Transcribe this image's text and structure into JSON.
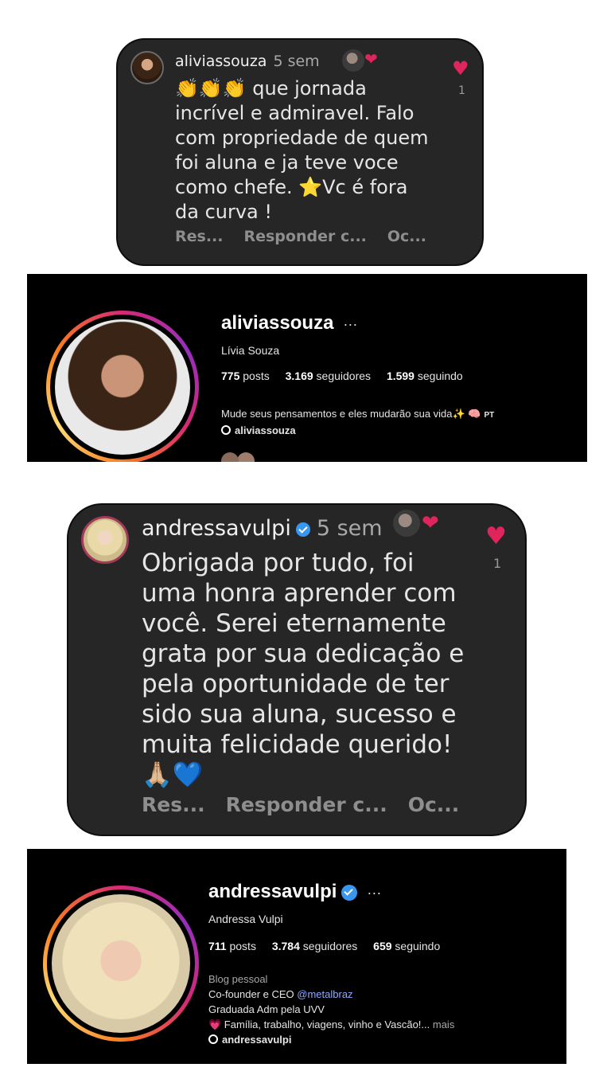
{
  "comment1": {
    "username": "aliviassouza",
    "time": "5 sem",
    "heart_badge": "❤",
    "lines": [
      "👏👏👏 que jornada",
      "incrível e admiravel. Falo",
      "com propriedade de quem",
      "foi aluna e ja teve voce",
      "como chefe. ⭐Vc é fora",
      "da curva !"
    ],
    "actions": [
      "Res...",
      "Responder c...",
      "Oc..."
    ],
    "like_icon": "♥",
    "like_count": "1"
  },
  "profile1": {
    "username": "aliviassouza",
    "more": "···",
    "name": "Lívia Souza",
    "posts_num": "775",
    "posts_label": "posts",
    "followers_num": "3.169",
    "followers_label": "seguidores",
    "following_num": "1.599",
    "following_label": "seguindo",
    "bio_line": "Mude seus pensamentos e eles mudarão sua vida✨ 🧠",
    "bio_pt": "PT",
    "threads_handle": "aliviassouza"
  },
  "comment2": {
    "username": "andressavulpi",
    "time": "5 sem",
    "heart_badge": "❤",
    "lines": [
      "Obrigada por tudo, foi",
      "uma honra aprender com",
      "você. Serei eternamente",
      "grata por sua dedicação e",
      "pela oportunidade de ter",
      "sido sua aluna, sucesso e",
      "muita felicidade querido!",
      "🙏🏼💙"
    ],
    "actions": [
      "Res...",
      "Responder c...",
      "Oc..."
    ],
    "like_icon": "♥",
    "like_count": "1"
  },
  "profile2": {
    "username": "andressavulpi",
    "more": "···",
    "name": "Andressa Vulpi",
    "posts_num": "711",
    "posts_label": "posts",
    "followers_num": "3.784",
    "followers_label": "seguidores",
    "following_num": "659",
    "following_label": "seguindo",
    "category": "Blog pessoal",
    "bio_line1_prefix": "Co-founder e CEO ",
    "bio_line1_mention": "@metalbraz",
    "bio_line2": "Graduada Adm pela UVV",
    "bio_line3": "💗 Família, trabalho, viagens, vinho e Vascão!...",
    "bio_more": "mais",
    "threads_handle": "andressavulpi"
  },
  "colors": {
    "card_bg": "#262626",
    "panel_bg": "#000000",
    "heart": "#e0245e",
    "verified": "#3897f0",
    "mention": "#8fa8ff"
  }
}
